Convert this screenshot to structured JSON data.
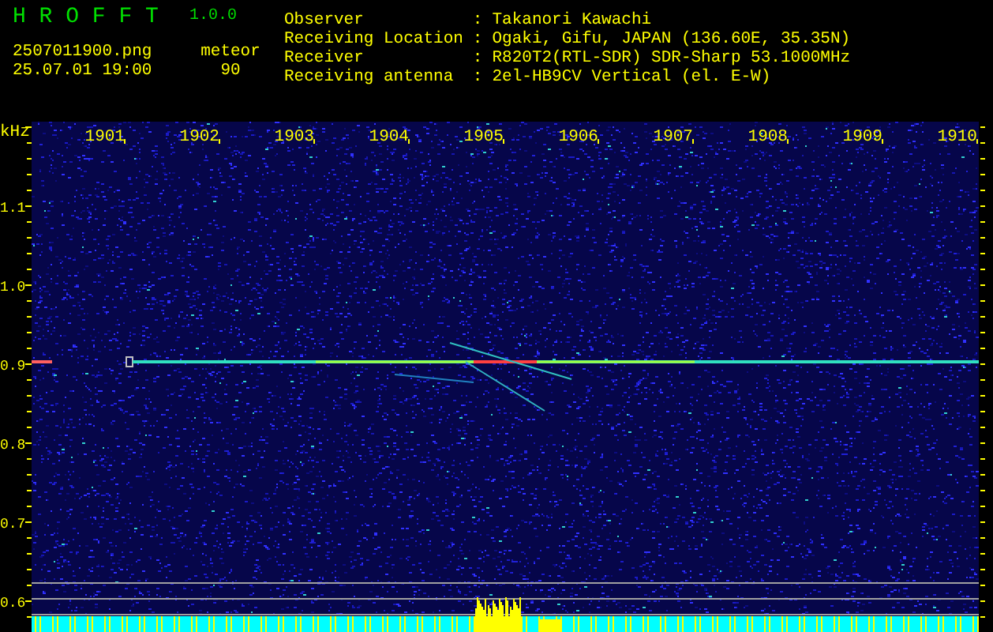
{
  "app": {
    "title": "H R O F F T",
    "version": "1.0.0"
  },
  "file": {
    "name": "2507011900.png",
    "timestamp": "25.07.01 19:00"
  },
  "detection": {
    "label": "meteor",
    "count": "90"
  },
  "info": [
    {
      "label": "Observer",
      "separator": ":",
      "value": "Takanori Kawachi"
    },
    {
      "label": "Receiving Location",
      "separator": ":",
      "value": "Ogaki, Gifu, JAPAN (136.60E, 35.35N)"
    },
    {
      "label": "Receiver",
      "separator": ":",
      "value": "R820T2(RTL-SDR) SDR-Sharp 53.1000MHz"
    },
    {
      "label": "Receiving antenna",
      "separator": ":",
      "value": "2el-HB9CV Vertical (el. E-W)"
    }
  ],
  "spectrogram": {
    "unit": "kHz",
    "x_labels": [
      "1901",
      "1902",
      "1903",
      "1904",
      "1905",
      "1906",
      "1907",
      "1908",
      "1909",
      "1910"
    ],
    "y_labels": [
      "1.1",
      "1.0",
      "0.9",
      "0.8",
      "0.7",
      "0.6"
    ]
  }
}
